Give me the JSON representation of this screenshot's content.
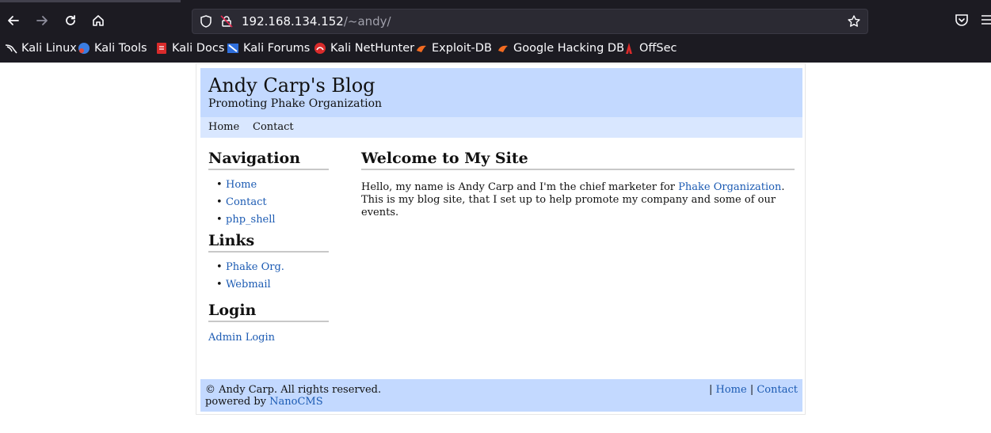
{
  "browser": {
    "url_host": "192.168.134.152",
    "url_path": "/~andy/",
    "bookmarks": [
      {
        "label": "Kali Linux",
        "icon": "kali-dragon-icon"
      },
      {
        "label": "Kali Tools",
        "icon": "kali-tools-icon"
      },
      {
        "label": "Kali Docs",
        "icon": "kali-docs-icon"
      },
      {
        "label": "Kali Forums",
        "icon": "kali-forums-icon"
      },
      {
        "label": "Kali NetHunter",
        "icon": "kali-nethunter-icon"
      },
      {
        "label": "Exploit-DB",
        "icon": "exploit-db-icon"
      },
      {
        "label": "Google Hacking DB",
        "icon": "ghdb-icon"
      },
      {
        "label": "OffSec",
        "icon": "offsec-icon"
      }
    ]
  },
  "site": {
    "title": "Andy Carp's Blog",
    "subtitle": "Promoting Phake Organization",
    "topnav": [
      "Home",
      "Contact"
    ]
  },
  "sidebar": {
    "navigation": {
      "heading": "Navigation",
      "items": [
        "Home",
        "Contact",
        "php_shell"
      ]
    },
    "links": {
      "heading": "Links",
      "items": [
        "Phake Org.",
        "Webmail"
      ]
    },
    "login": {
      "heading": "Login",
      "link": "Admin Login"
    }
  },
  "main": {
    "heading": "Welcome to My Site",
    "text_before": "Hello, my name is Andy Carp and I'm the chief marketer for ",
    "link_text": "Phake Organization",
    "text_after": ". This is my blog site, that I set up to help promote my company and some of our events."
  },
  "footer": {
    "copyright": "© Andy Carp. All rights reserved.",
    "powered_prefix": "powered by ",
    "powered_link": "NanoCMS",
    "sep1": "| ",
    "link_home": "Home",
    "sep2": " | ",
    "link_contact": "Contact"
  },
  "colors": {
    "header_bg": "#c3d9ff",
    "nav_bg": "#d9e7ff",
    "link": "#1c5bb3",
    "chrome_bg": "#1c1b22"
  }
}
